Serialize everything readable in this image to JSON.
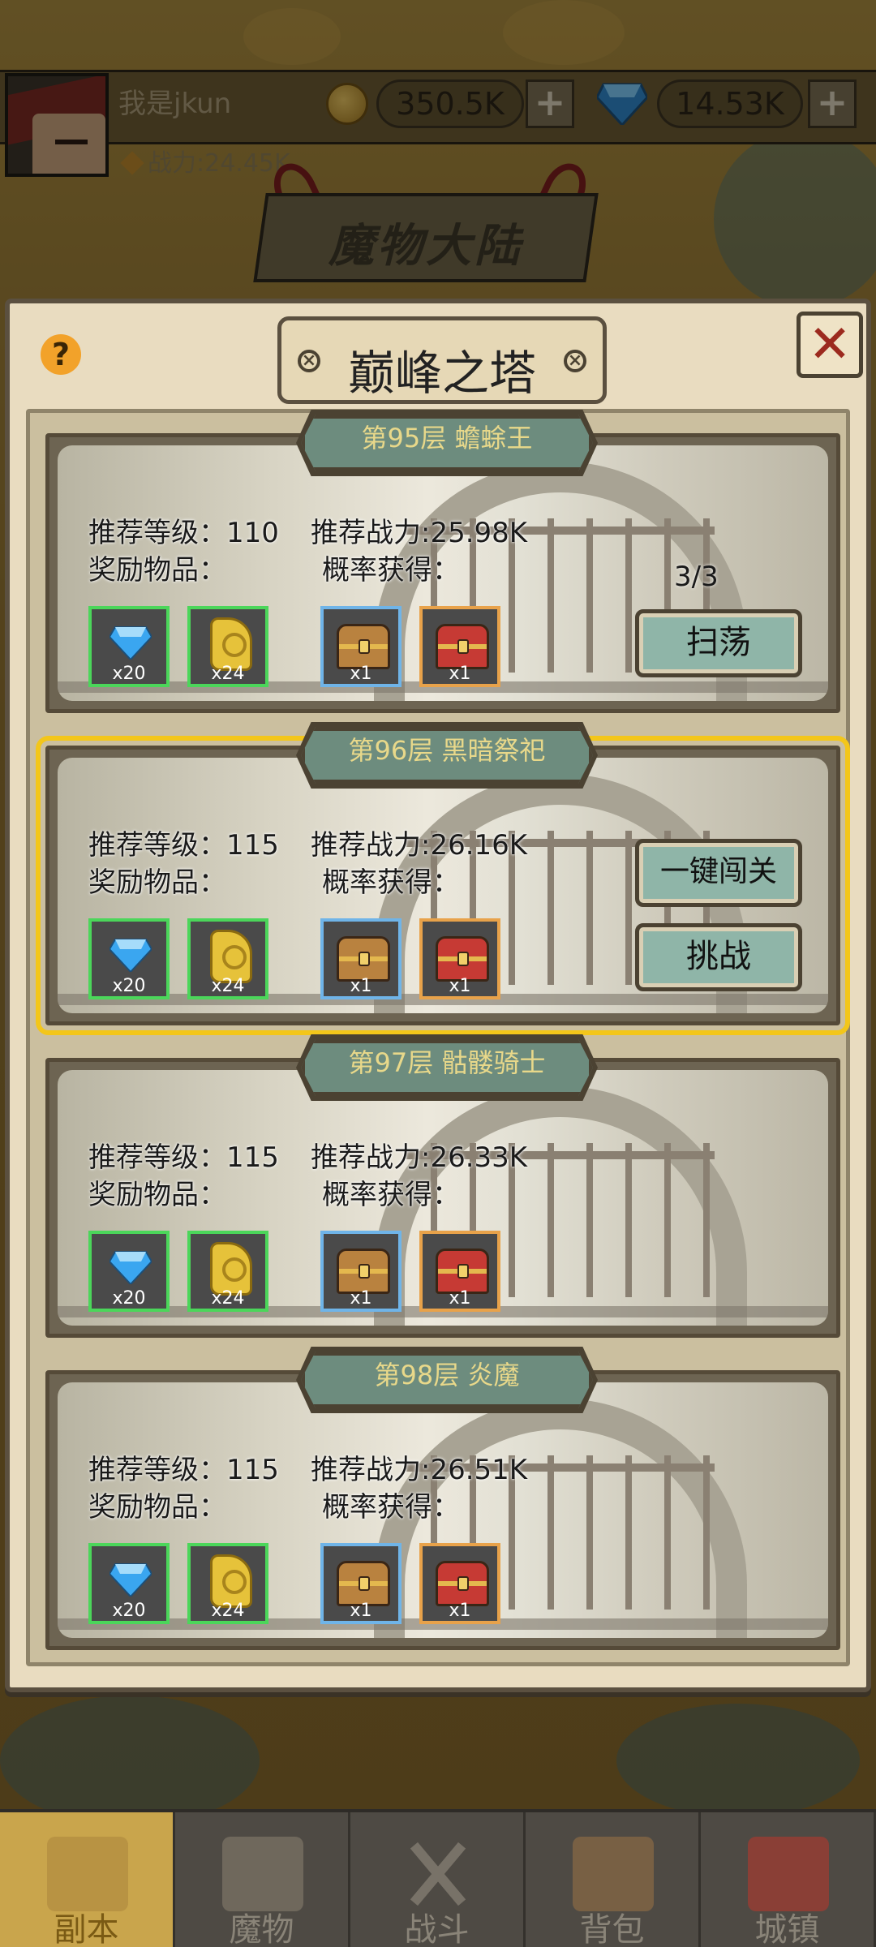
{
  "header": {
    "player_name": "我是jkun",
    "power": "战力:24.45K",
    "coins": "350.5K",
    "gems": "14.53K",
    "plus": "+",
    "map_title": "魔物大陆"
  },
  "modal": {
    "title": "巅峰之塔",
    "help": "?",
    "close": "✕"
  },
  "floors": [
    {
      "title": "第95层   蟾蜍王",
      "rec_level": "推荐等级：110",
      "rec_power": "推荐战力:25.98K",
      "reward_label": "奖励物品：",
      "chance_label": "概率获得：",
      "items": [
        "x20",
        "x24",
        "x1",
        "x1"
      ],
      "count": "3/3",
      "button": "扫荡"
    },
    {
      "title": "第96层  黑暗祭祀",
      "rec_level": "推荐等级：115",
      "rec_power": "推荐战力:26.16K",
      "reward_label": "奖励物品：",
      "chance_label": "概率获得：",
      "items": [
        "x20",
        "x24",
        "x1",
        "x1"
      ],
      "button_onekey": "一键闯关",
      "button": "挑战"
    },
    {
      "title": "第97层  骷髅骑士",
      "rec_level": "推荐等级：115",
      "rec_power": "推荐战力:26.33K",
      "reward_label": "奖励物品：",
      "chance_label": "概率获得：",
      "items": [
        "x20",
        "x24",
        "x1",
        "x1"
      ]
    },
    {
      "title": "第98层   炎魔",
      "rec_level": "推荐等级：115",
      "rec_power": "推荐战力:26.51K",
      "reward_label": "奖励物品：",
      "chance_label": "概率获得：",
      "items": [
        "x20",
        "x24",
        "x1",
        "x1"
      ]
    }
  ],
  "nav": [
    "副本",
    "魔物",
    "战斗",
    "背包",
    "城镇"
  ],
  "colors": {
    "selected_outline": "#f3c61a",
    "button_fill": "#8fb5a8",
    "gem": "#3aa6f0",
    "gold": "#e6c23a"
  }
}
